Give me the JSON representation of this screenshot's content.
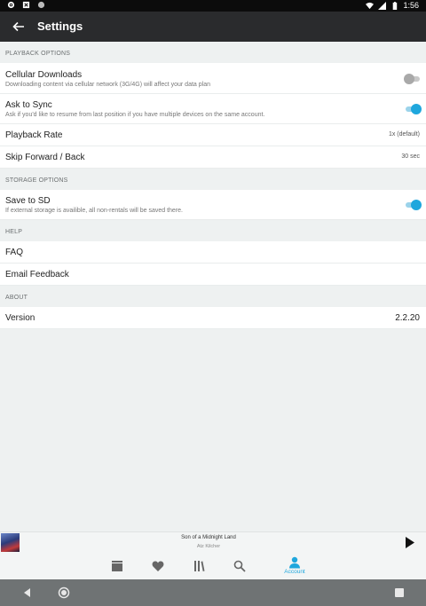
{
  "status_bar": {
    "time": "1:56"
  },
  "app_bar": {
    "title": "Settings"
  },
  "sections": {
    "playback": {
      "header": "PLAYBACK OPTIONS",
      "cellular": {
        "label": "Cellular Downloads",
        "sub": "Downloading content via cellular network (3G/4G) will affect your data plan",
        "enabled": false
      },
      "sync": {
        "label": "Ask to Sync",
        "sub": "Ask if you'd like to resume from last position if you have multiple devices on the same account.",
        "enabled": true
      },
      "rate": {
        "label": "Playback Rate",
        "value": "1x (default)"
      },
      "skip": {
        "label": "Skip Forward / Back",
        "value": "30 sec"
      }
    },
    "storage": {
      "header": "STORAGE OPTIONS",
      "sd": {
        "label": "Save to SD",
        "sub": "If external storage is availible, all non-rentals will be saved there.",
        "enabled": true
      }
    },
    "help": {
      "header": "HELP",
      "faq": {
        "label": "FAQ"
      },
      "feedback": {
        "label": "Email Feedback"
      }
    },
    "about": {
      "header": "ABOUT",
      "version": {
        "label": "Version",
        "value": "2.2.20"
      }
    }
  },
  "mini_player": {
    "title": "Son of a Midnight Land",
    "artist": "Atz Kilcher"
  },
  "bottom_nav": {
    "items": [
      {
        "icon": "store-icon"
      },
      {
        "icon": "heart-icon"
      },
      {
        "icon": "library-icon"
      },
      {
        "icon": "search-icon"
      },
      {
        "icon": "account-icon",
        "label": "Account",
        "active": true
      }
    ]
  },
  "colors": {
    "accent": "#1fa7dd",
    "app_bar": "#2a2b2d",
    "background": "#eef1f1"
  }
}
